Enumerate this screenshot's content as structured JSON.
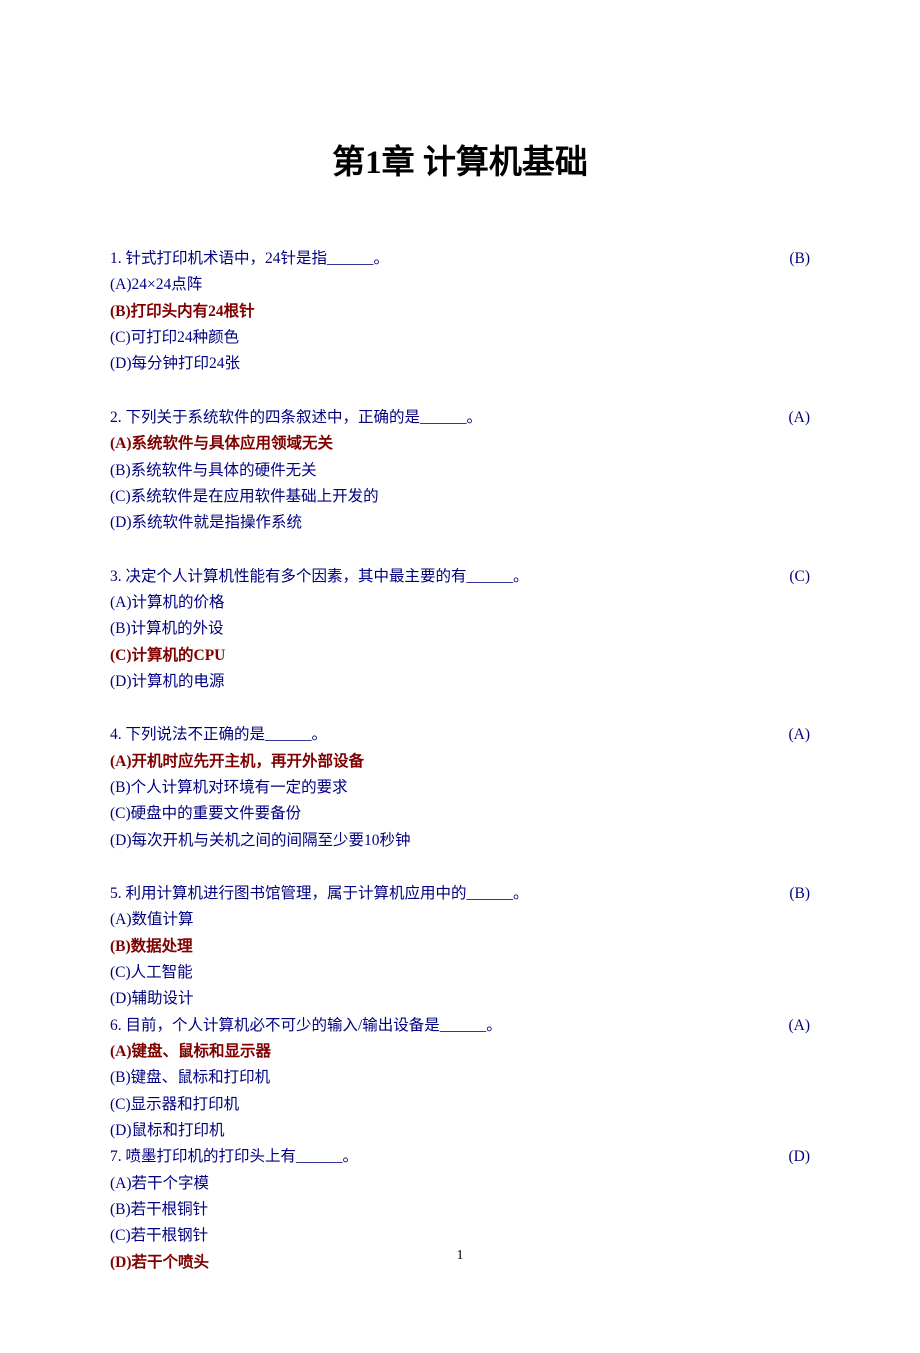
{
  "title": "第1章 计算机基础",
  "page_number": "1",
  "questions": [
    {
      "num": "1.",
      "stem": "针式打印机术语中，24针是指______。",
      "answer": "(B)",
      "options": [
        {
          "label": "(A)24×24点阵",
          "correct": false
        },
        {
          "label": "(B)打印头内有24根针",
          "correct": true
        },
        {
          "label": "(C)可打印24种颜色",
          "correct": false
        },
        {
          "label": "(D)每分钟打印24张",
          "correct": false
        }
      ]
    },
    {
      "num": "2.",
      "stem": "下列关于系统软件的四条叙述中，正确的是______。",
      "answer": "(A)",
      "options": [
        {
          "label": "(A)系统软件与具体应用领域无关",
          "correct": true
        },
        {
          "label": "(B)系统软件与具体的硬件无关",
          "correct": false
        },
        {
          "label": "(C)系统软件是在应用软件基础上开发的",
          "correct": false
        },
        {
          "label": "(D)系统软件就是指操作系统",
          "correct": false
        }
      ]
    },
    {
      "num": "3.",
      "stem": "决定个人计算机性能有多个因素，其中最主要的有______。",
      "answer": "(C)",
      "options": [
        {
          "label": "(A)计算机的价格",
          "correct": false
        },
        {
          "label": "(B)计算机的外设",
          "correct": false
        },
        {
          "label": "(C)计算机的CPU",
          "correct": true
        },
        {
          "label": "(D)计算机的电源",
          "correct": false
        }
      ]
    },
    {
      "num": "4.",
      "stem": "下列说法不正确的是______。",
      "answer": "(A)",
      "options": [
        {
          "label": "(A)开机时应先开主机，再开外部设备",
          "correct": true
        },
        {
          "label": "(B)个人计算机对环境有一定的要求",
          "correct": false
        },
        {
          "label": "(C)硬盘中的重要文件要备份",
          "correct": false
        },
        {
          "label": "(D)每次开机与关机之间的间隔至少要10秒钟",
          "correct": false
        }
      ]
    },
    {
      "num": "5.",
      "stem": "利用计算机进行图书馆管理，属于计算机应用中的______。",
      "answer": "(B)",
      "options": [
        {
          "label": "(A)数值计算",
          "correct": false
        },
        {
          "label": "(B)数据处理",
          "correct": true
        },
        {
          "label": "(C)人工智能",
          "correct": false
        },
        {
          "label": "(D)辅助设计",
          "correct": false
        }
      ]
    },
    {
      "num": "6.",
      "stem": "目前，个人计算机必不可少的输入/输出设备是______。",
      "answer": "(A)",
      "options": [
        {
          "label": "(A)键盘、鼠标和显示器",
          "correct": true
        },
        {
          "label": "(B)键盘、鼠标和打印机",
          "correct": false
        },
        {
          "label": "(C)显示器和打印机",
          "correct": false
        },
        {
          "label": "(D)鼠标和打印机",
          "correct": false
        }
      ]
    },
    {
      "num": "7.",
      "stem": "喷墨打印机的打印头上有______。",
      "answer": "(D)",
      "options": [
        {
          "label": "(A)若干个字模",
          "correct": false
        },
        {
          "label": "(B)若干根铜针",
          "correct": false
        },
        {
          "label": "(C)若干根钢针",
          "correct": false
        },
        {
          "label": "(D)若干个喷头",
          "correct": true
        }
      ]
    }
  ]
}
